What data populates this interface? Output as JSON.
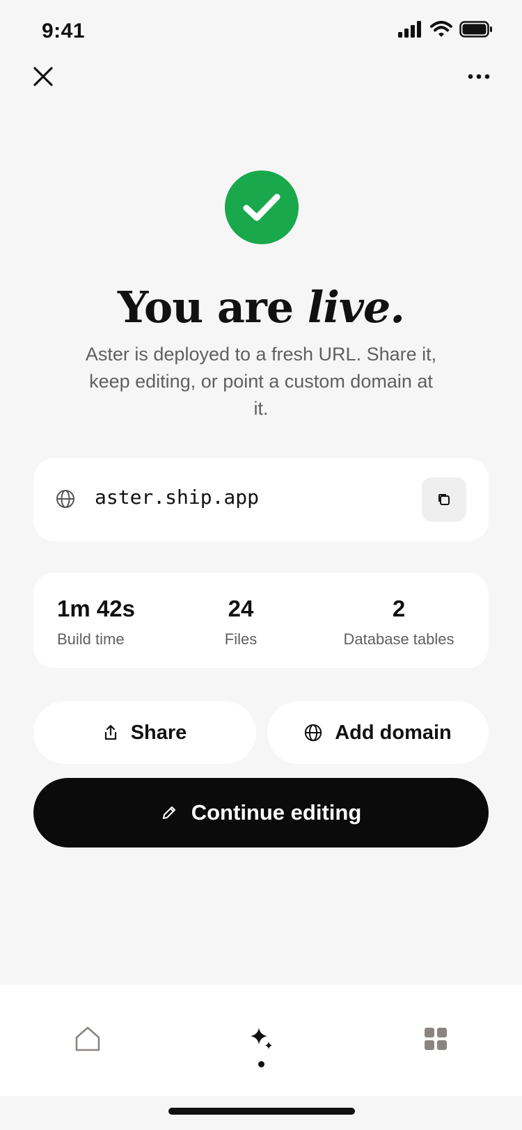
{
  "status_bar": {
    "time": "9:41"
  },
  "hero": {
    "headline_regular": "You are ",
    "headline_italic": "live.",
    "subtitle": "Aster is deployed to a fresh URL. Share it, keep editing, or point a custom domain at it."
  },
  "url_card": {
    "url": "aster.ship.app"
  },
  "stats": [
    {
      "value": "1m 42s",
      "label": "Build time"
    },
    {
      "value": "24",
      "label": "Files"
    },
    {
      "value": "2",
      "label": "Database tables"
    }
  ],
  "actions": {
    "share_label": "Share",
    "add_domain_label": "Add domain",
    "continue_label": "Continue editing"
  },
  "colors": {
    "success": "#19a84c",
    "primary_button": "#0b0b0b",
    "background": "#f6f6f6"
  },
  "icons": {
    "close": "close-icon",
    "more": "more-icon",
    "success": "checkmark-icon",
    "globe": "globe-icon",
    "copy": "copy-icon",
    "share": "share-icon",
    "pencil": "pencil-icon",
    "home_tab": "home-icon",
    "spark_tab": "sparkle-icon",
    "grid_tab": "grid-icon"
  }
}
